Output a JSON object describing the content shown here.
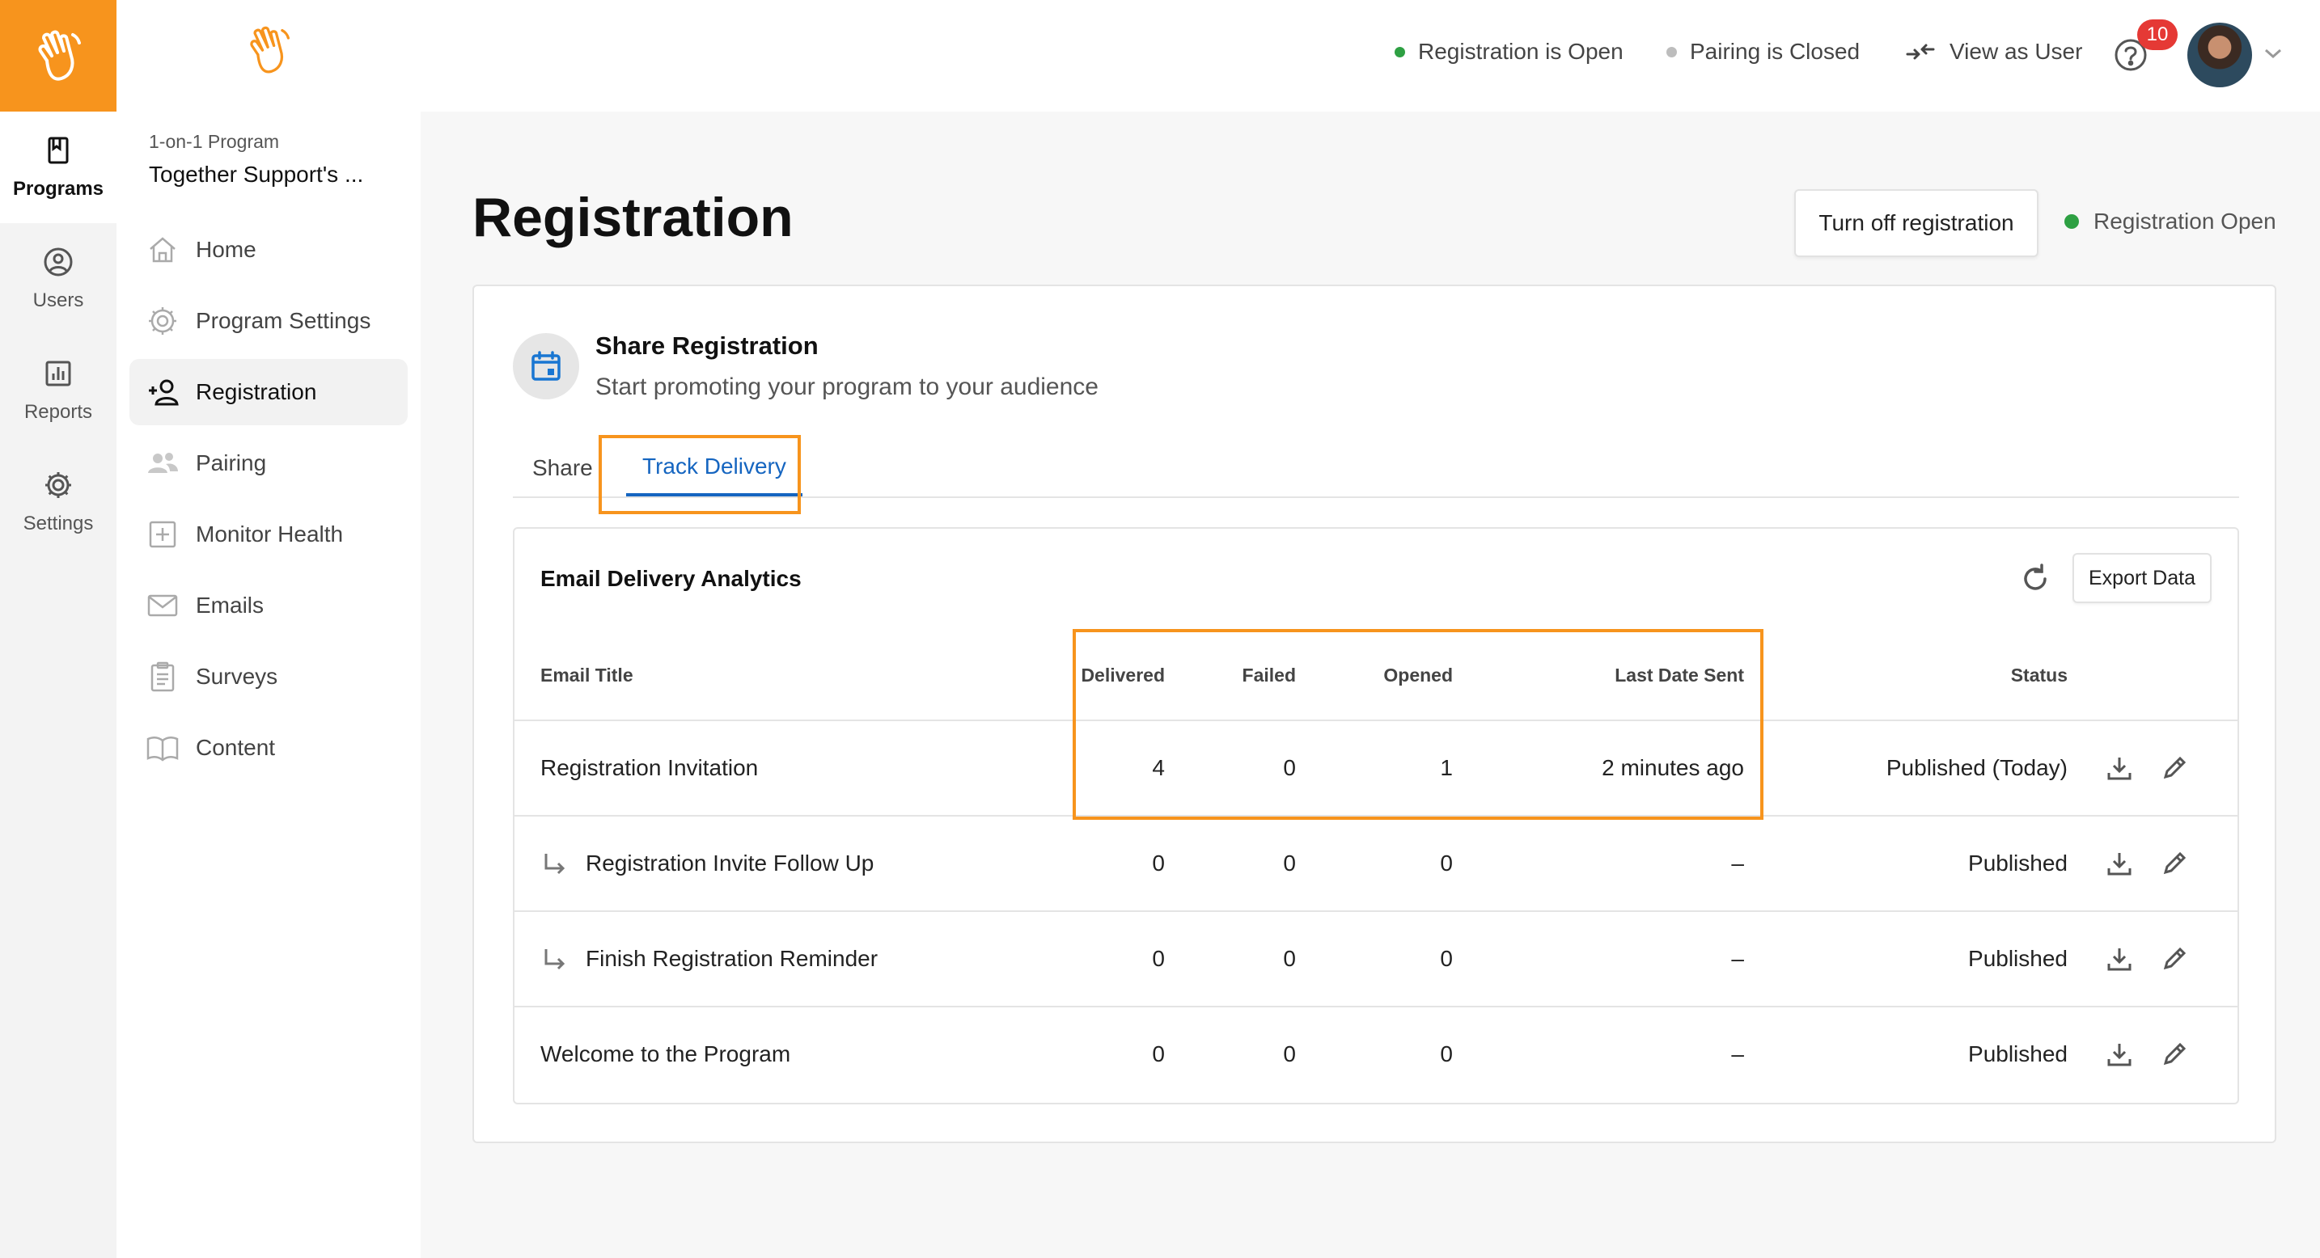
{
  "rail": {
    "items": [
      {
        "label": "Programs",
        "icon": "bookmark-icon"
      },
      {
        "label": "Users",
        "icon": "user-circle-icon"
      },
      {
        "label": "Reports",
        "icon": "bar-chart-icon"
      },
      {
        "label": "Settings",
        "icon": "gear-icon"
      }
    ]
  },
  "sidebar": {
    "program_type": "1-on-1 Program",
    "program_name": "Together Support's ...",
    "items": [
      {
        "label": "Home",
        "icon": "home-icon"
      },
      {
        "label": "Program Settings",
        "icon": "gear-icon"
      },
      {
        "label": "Registration",
        "icon": "add-user-icon"
      },
      {
        "label": "Pairing",
        "icon": "people-icon"
      },
      {
        "label": "Monitor Health",
        "icon": "plus-box-icon"
      },
      {
        "label": "Emails",
        "icon": "mail-icon"
      },
      {
        "label": "Surveys",
        "icon": "clipboard-icon"
      },
      {
        "label": "Content",
        "icon": "book-icon"
      }
    ]
  },
  "topbar": {
    "registration_status": "Registration is Open",
    "pairing_status": "Pairing is Closed",
    "view_as_user": "View as User",
    "notification_count": "10"
  },
  "page": {
    "title": "Registration",
    "turn_off_label": "Turn off registration",
    "status_label": "Registration Open"
  },
  "share": {
    "title": "Share Registration",
    "subtitle": "Start promoting your program to your audience",
    "tabs": {
      "share": "Share",
      "track": "Track Delivery"
    }
  },
  "analytics": {
    "title": "Email Delivery Analytics",
    "export_label": "Export Data",
    "columns": {
      "email_title": "Email Title",
      "delivered": "Delivered",
      "failed": "Failed",
      "opened": "Opened",
      "last_date_sent": "Last Date Sent",
      "status": "Status"
    },
    "rows": [
      {
        "title": "Registration Invitation",
        "delivered": "4",
        "failed": "0",
        "opened": "1",
        "last_sent": "2 minutes ago",
        "status": "Published (Today)"
      },
      {
        "title": "Registration Invite Follow Up",
        "delivered": "0",
        "failed": "0",
        "opened": "0",
        "last_sent": "–",
        "status": "Published"
      },
      {
        "title": "Finish Registration Reminder",
        "delivered": "0",
        "failed": "0",
        "opened": "0",
        "last_sent": "–",
        "status": "Published"
      },
      {
        "title": "Welcome to the Program",
        "delivered": "0",
        "failed": "0",
        "opened": "0",
        "last_sent": "–",
        "status": "Published"
      }
    ]
  },
  "colors": {
    "brand_orange": "#f7941d",
    "status_green": "#2ea043",
    "status_gray": "#bdbdbd",
    "link_blue": "#1565c0",
    "badge_red": "#e53935"
  }
}
